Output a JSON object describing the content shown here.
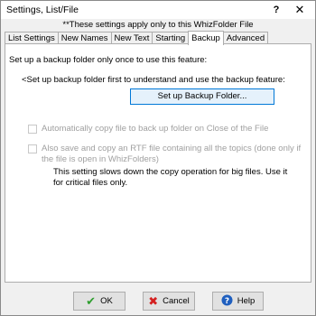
{
  "window": {
    "title": "Settings, List/File",
    "help_glyph": "?",
    "close_glyph": "✕"
  },
  "notice": "**These settings apply only to this WhizFolder File",
  "tabs": [
    {
      "label": "List Settings",
      "active": false
    },
    {
      "label": "New Names",
      "active": false
    },
    {
      "label": "New Text",
      "active": false
    },
    {
      "label": "Starting",
      "active": false
    },
    {
      "label": "Backup",
      "active": true
    },
    {
      "label": "Advanced",
      "active": false
    }
  ],
  "backup": {
    "intro": "Set up a backup folder only once to use this feature:",
    "hint": "<Set up backup folder first to understand and use the backup feature:",
    "setup_button": "Set up Backup Folder...",
    "auto_copy_label": "Automatically copy file to back up folder on Close of the File",
    "auto_copy_checked": false,
    "rtf_label_line1": "Also save and copy an RTF file containing all the topics (done only if",
    "rtf_label_line2": "the file is open in WhizFolders)",
    "rtf_checked": false,
    "note_line1": "This setting slows down the copy operation for big files. Use it",
    "note_line2": "for critical files only."
  },
  "buttons": {
    "ok": "OK",
    "cancel": "Cancel",
    "help": "Help"
  },
  "colors": {
    "ok_icon": "#2e9e2e",
    "cancel_icon": "#d42020",
    "help_icon": "#1f5fbf"
  }
}
